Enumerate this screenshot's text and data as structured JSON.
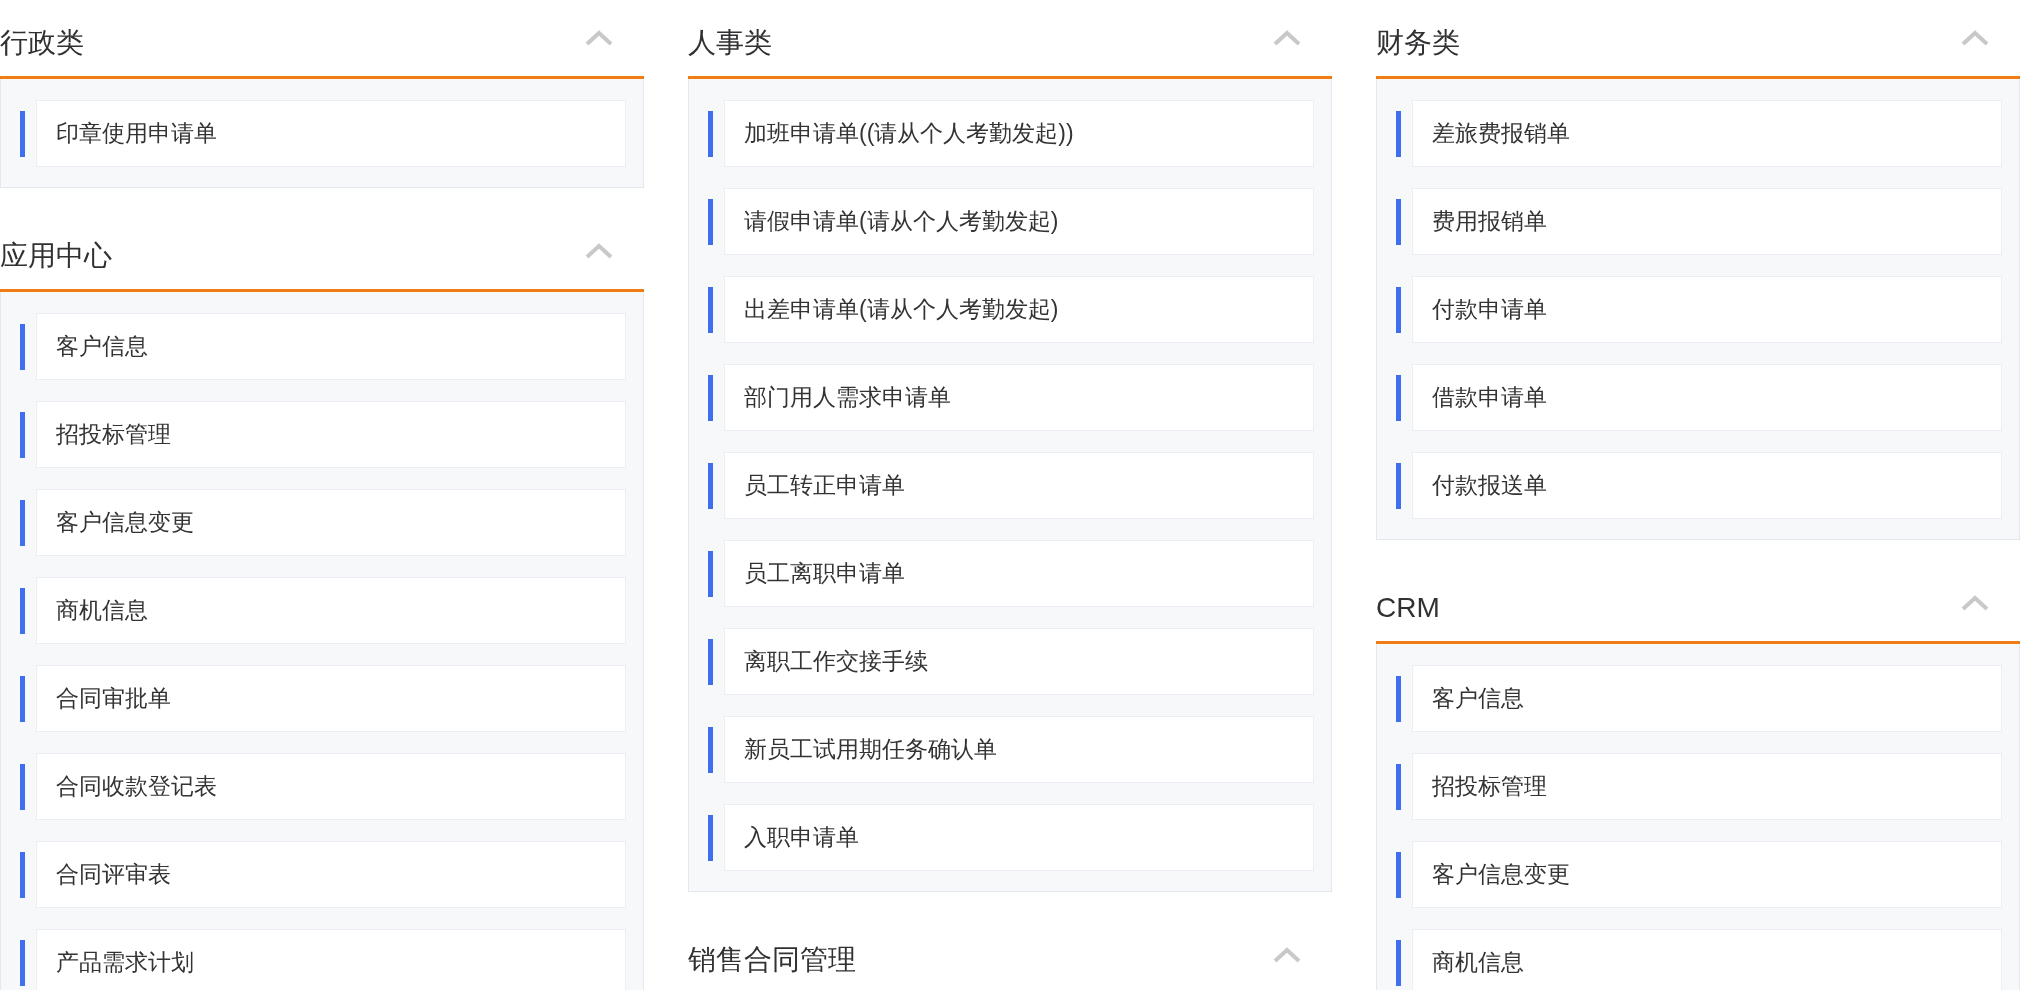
{
  "columns": [
    {
      "sections": [
        {
          "title": "行政类",
          "expanded": true,
          "items": [
            "印章使用申请单"
          ]
        },
        {
          "title": "应用中心",
          "expanded": true,
          "items": [
            "客户信息",
            "招投标管理",
            "客户信息变更",
            "商机信息",
            "合同审批单",
            "合同收款登记表",
            "合同评审表",
            "产品需求计划"
          ]
        }
      ]
    },
    {
      "sections": [
        {
          "title": "人事类",
          "expanded": true,
          "items": [
            "加班申请单((请从个人考勤发起))",
            "请假申请单(请从个人考勤发起)",
            "出差申请单(请从个人考勤发起)",
            "部门用人需求申请单",
            "员工转正申请单",
            "员工离职申请单",
            "离职工作交接手续",
            "新员工试用期任务确认单",
            "入职申请单"
          ]
        },
        {
          "title": "销售合同管理",
          "expanded": true
        }
      ]
    },
    {
      "sections": [
        {
          "title": "财务类",
          "expanded": true,
          "items": [
            "差旅费报销单",
            "费用报销单",
            "付款申请单",
            "借款申请单",
            "付款报送单"
          ]
        },
        {
          "title": "CRM",
          "expanded": true,
          "items": [
            "客户信息",
            "招投标管理",
            "客户信息变更",
            "商机信息"
          ]
        }
      ]
    }
  ]
}
